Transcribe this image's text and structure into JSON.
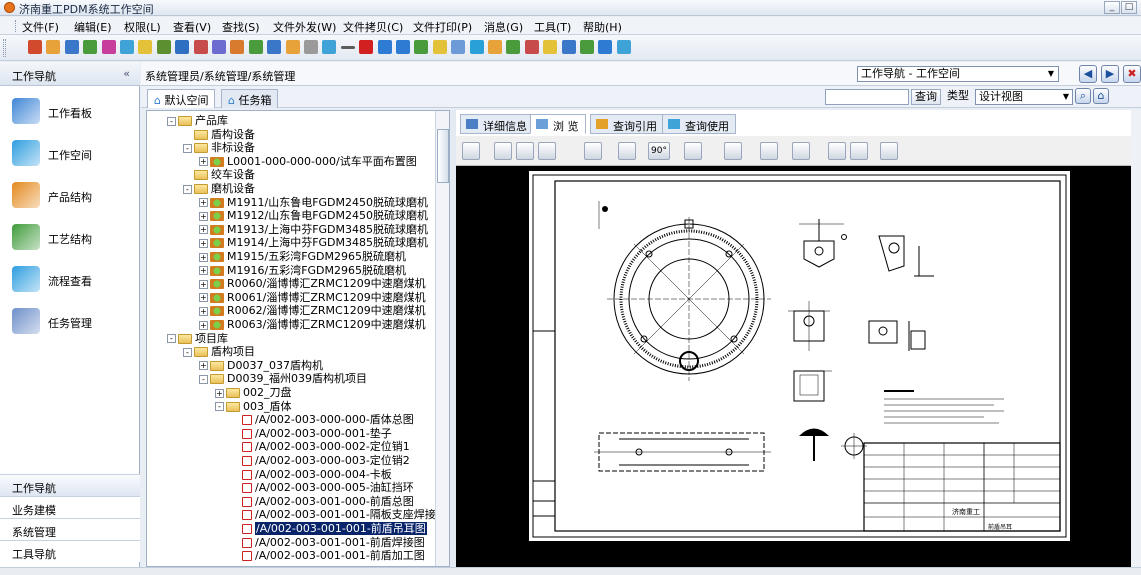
{
  "window": {
    "title": "济南重工PDM系统工作空间",
    "controls": [
      "_",
      "□"
    ]
  },
  "menu": [
    {
      "label": "文件(F)"
    },
    {
      "label": "编辑(E)"
    },
    {
      "label": "权限(L)"
    },
    {
      "label": "查看(V)"
    },
    {
      "label": "查找(S)"
    },
    {
      "label": "文件外发(W)"
    },
    {
      "label": "文件拷贝(C)"
    },
    {
      "label": "文件打印(P)"
    },
    {
      "label": "消息(G)"
    },
    {
      "label": "工具(T)"
    },
    {
      "label": "帮助(H)"
    }
  ],
  "toolbar_colors": [
    "#d24a2e",
    "#e8a23a",
    "#3b77c8",
    "#4a9b3c",
    "#c63d9b",
    "#3fa3d8",
    "#e3c23a",
    "#5b8f2f",
    "#2f6fc2",
    "#c84b4b",
    "#6c6cd0",
    "#d97b2e",
    "#4a9b3c",
    "#3b77c8",
    "#e8a23a",
    "#9a9a9a",
    "#3fa3d8",
    "#5c5c5c",
    "#d21f1f",
    "#2e7bd4",
    "#2e7bd4",
    "#4a9b3c",
    "#e3c23a",
    "#6c9bd8",
    "#2aa0d8",
    "#e8a23a",
    "#4a9b3c",
    "#c84b4b",
    "#e3c23a",
    "#3b77c8",
    "#4a9b3c",
    "#2e7bd4",
    "#3fa3d8"
  ],
  "nav": {
    "title": "工作导航",
    "collapse": "«",
    "items": [
      {
        "label": "工作看板",
        "icon": "dashboard-icon",
        "color": "#3f86d6"
      },
      {
        "label": "工作空间",
        "icon": "home-icon",
        "color": "#2f9ee0"
      },
      {
        "label": "产品结构",
        "icon": "product-structure-icon",
        "color": "#e38a1e"
      },
      {
        "label": "工艺结构",
        "icon": "process-structure-icon",
        "color": "#3f9b3a"
      },
      {
        "label": "流程查看",
        "icon": "workflow-icon",
        "color": "#2f9ee0"
      },
      {
        "label": "任务管理",
        "icon": "task-icon",
        "color": "#6d8fc9"
      }
    ],
    "bottom": [
      {
        "label": "工作导航",
        "active": true
      },
      {
        "label": "业务建模",
        "active": false
      },
      {
        "label": "系统管理",
        "active": false
      },
      {
        "label": "工具导航",
        "active": false
      }
    ]
  },
  "breadcrumb": "系统管理员/系统管理/系统管理",
  "workspace_select": "工作导航 - 工作空间",
  "space_tabs": [
    {
      "label": "默认空间",
      "active": true
    },
    {
      "label": "任务箱",
      "active": false
    }
  ],
  "search": {
    "query_btn": "查询",
    "type_label": "类型",
    "view_select": "设计视图"
  },
  "tree": [
    {
      "label": "产品库",
      "level": 0,
      "icon": "folder",
      "toggle": "-"
    },
    {
      "label": "盾构设备",
      "level": 1,
      "icon": "folder",
      "toggle": ""
    },
    {
      "label": "非标设备",
      "level": 1,
      "icon": "folder",
      "toggle": "-"
    },
    {
      "label": "L0001-000-000-000/试车平面布置图",
      "level": 2,
      "icon": "part",
      "toggle": "+"
    },
    {
      "label": "绞车设备",
      "level": 1,
      "icon": "folder",
      "toggle": ""
    },
    {
      "label": "磨机设备",
      "level": 1,
      "icon": "folder",
      "toggle": "-"
    },
    {
      "label": "M1911/山东鲁电FGDM2450脱硫球磨机",
      "level": 2,
      "icon": "part",
      "toggle": "+"
    },
    {
      "label": "M1912/山东鲁电FGDM2450脱硫球磨机",
      "level": 2,
      "icon": "part",
      "toggle": "+"
    },
    {
      "label": "M1913/上海中芬FGDM3485脱硫球磨机",
      "level": 2,
      "icon": "part",
      "toggle": "+"
    },
    {
      "label": "M1914/上海中芬FGDM3485脱硫球磨机",
      "level": 2,
      "icon": "part",
      "toggle": "+"
    },
    {
      "label": "M1915/五彩湾FGDM2965脱硫磨机",
      "level": 2,
      "icon": "part",
      "toggle": "+"
    },
    {
      "label": "M1916/五彩湾FGDM2965脱硫磨机",
      "level": 2,
      "icon": "part",
      "toggle": "+"
    },
    {
      "label": "R0060/淄博博汇ZRMC1209中速磨煤机",
      "level": 2,
      "icon": "part",
      "toggle": "+"
    },
    {
      "label": "R0061/淄博博汇ZRMC1209中速磨煤机",
      "level": 2,
      "icon": "part",
      "toggle": "+"
    },
    {
      "label": "R0062/淄博博汇ZRMC1209中速磨煤机",
      "level": 2,
      "icon": "part",
      "toggle": "+"
    },
    {
      "label": "R0063/淄博博汇ZRMC1209中速磨煤机",
      "level": 2,
      "icon": "part",
      "toggle": "+"
    },
    {
      "label": "项目库",
      "level": 0,
      "icon": "folder",
      "toggle": "-"
    },
    {
      "label": "盾构项目",
      "level": 1,
      "icon": "folder",
      "toggle": "-"
    },
    {
      "label": "D0037_037盾构机",
      "level": 2,
      "icon": "folder",
      "toggle": "+"
    },
    {
      "label": "D0039_福州039盾构机项目",
      "level": 2,
      "icon": "folder",
      "toggle": "-"
    },
    {
      "label": "002_刀盘",
      "level": 3,
      "icon": "folder",
      "toggle": "+"
    },
    {
      "label": "003_盾体",
      "level": 3,
      "icon": "folder",
      "toggle": "-"
    },
    {
      "label": "/A/002-003-000-000-盾体总图",
      "level": 4,
      "icon": "doc",
      "toggle": ""
    },
    {
      "label": "/A/002-003-000-001-垫子",
      "level": 4,
      "icon": "doc",
      "toggle": ""
    },
    {
      "label": "/A/002-003-000-002-定位销1",
      "level": 4,
      "icon": "doc",
      "toggle": ""
    },
    {
      "label": "/A/002-003-000-003-定位销2",
      "level": 4,
      "icon": "doc",
      "toggle": ""
    },
    {
      "label": "/A/002-003-000-004-卡板",
      "level": 4,
      "icon": "doc",
      "toggle": ""
    },
    {
      "label": "/A/002-003-000-005-油缸挡环",
      "level": 4,
      "icon": "doc",
      "toggle": ""
    },
    {
      "label": "/A/002-003-001-000-前盾总图",
      "level": 4,
      "icon": "doc",
      "toggle": ""
    },
    {
      "label": "/A/002-003-001-001-隔板支座焊接",
      "level": 4,
      "icon": "doc",
      "toggle": ""
    },
    {
      "label": "/A/002-003-001-001-前盾吊耳图",
      "level": 4,
      "icon": "doc",
      "toggle": "",
      "selected": true
    },
    {
      "label": "/A/002-003-001-001-前盾焊接图",
      "level": 4,
      "icon": "doc",
      "toggle": ""
    },
    {
      "label": "/A/002-003-001-001-前盾加工图",
      "level": 4,
      "icon": "doc",
      "toggle": ""
    }
  ],
  "viewer_tabs": [
    {
      "label": "详细信息",
      "active": false
    },
    {
      "label": "浏 览",
      "active": true
    },
    {
      "label": "查询引用",
      "active": false
    },
    {
      "label": "查询使用",
      "active": false
    }
  ],
  "viewer_tools": {
    "zoom": "90°"
  },
  "drawing": {
    "title_block_name": "前盾吊耳",
    "title_block_company": "济南重工"
  }
}
